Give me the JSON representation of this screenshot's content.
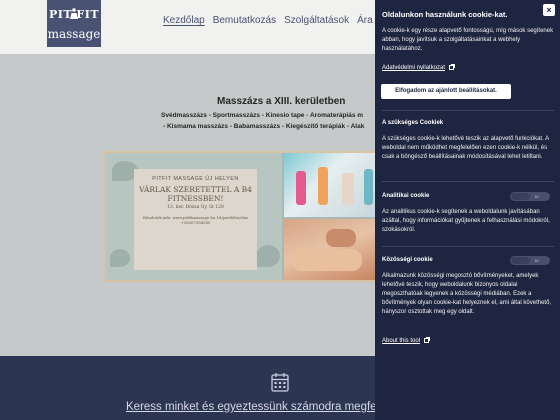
{
  "header": {
    "logo_top": "PIT FIT",
    "logo_bottom": "massage",
    "nav": [
      "Kezdőlap",
      "Bemutatkozás",
      "Szolgáltatások",
      "Ára"
    ]
  },
  "main": {
    "title": "Masszázs a XIII. kerületben",
    "services_line1": "Svédmasszázs - Sportmasszázs - Kinesio tape - Aromaterápiás m",
    "services_line2": "- Kismama masszázs - Babamasszázs - Kiegészítő terápiák - Alak",
    "poster": {
      "title": "PITFIT MASSAGE ÚJ HELYEN",
      "headline": "VÁRLAK SZERETETTEL A B4 FITNESSBEN!",
      "address": "13. ker. Dózsa Gy. út 128",
      "info": "Részletek info: www.pitfitmassage.hu 16/portfolio/elas +36307394280"
    }
  },
  "band": {
    "link": "Keress minket és egyeztessünk számodra megfelel"
  },
  "cookie": {
    "close_label": "×",
    "title": "Oldalunkon használunk cookie-kat.",
    "intro": "A cookie-k egy része alapvető fontosságú, míg mások segítenek abban, hogy javítsuk a szolgáltatásainkat a webhely használatához.",
    "privacy_link": "Adatvédelmi nyilatkozat",
    "accept_button": "Elfogadom az ajánlott beállításokat.",
    "necessary_title": "A szükséges Cookiek",
    "necessary_text": "A szükséges cookie-k lehetővé teszik az alapvető funkciókat. A weboldal nem működhet megfelelően ezen cookie-k nélkül, és csak a böngésző beállításainak módosításával lehet letiltani.",
    "analytics_title": "Analitikai cookie",
    "analytics_toggle": "Ki",
    "analytics_text": "Az analitikus cookie-k segítenek a weboldalunk javításában azáltal, hogy információkat gyűjtenek a felhasználási módokról, szokásokról.",
    "social_title": "Közösségi cookie",
    "social_toggle": "Ki",
    "social_text": "Alkalmazunk közösségi megosztó bővítményeket, amelyek lehetővé teszik, hogy weboldalunk bizonyos oldalai megoszthatóak legyenek a közösségi médiában. Ezek a bővítmények olyan cookie-kat helyeznek el, ami által követhető, hányszor osztottak meg egy oldalt.",
    "about_link": "About this tool"
  },
  "colors": {
    "brand": "#4a5273",
    "panel": "#1e2540",
    "band": "#2c3552"
  }
}
